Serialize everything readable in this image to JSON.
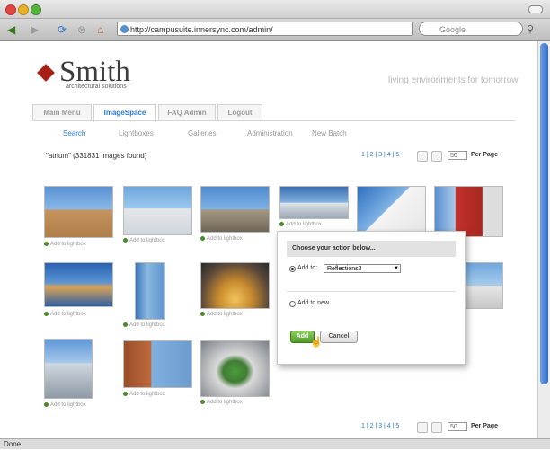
{
  "browser": {
    "url": "http://campusuite.innersync.com/admin/",
    "search_placeholder": "Google",
    "status": "Done"
  },
  "site": {
    "logo_name": "Smith",
    "logo_sub": "architectural solutions",
    "tagline": "living environments for tomorrow"
  },
  "tabs": [
    {
      "label": "Main Menu"
    },
    {
      "label": "ImageSpace"
    },
    {
      "label": "FAQ Admin"
    },
    {
      "label": "Logout"
    }
  ],
  "subnav": [
    "Search",
    "Lightboxes",
    "Galleries",
    "Administration",
    "New Batch"
  ],
  "results_text": "\"atrium\" (331831 images found)",
  "pager": {
    "pages": "1 | 2 | 3 | 4 | 5",
    "per_page_value": "50",
    "per_page_label": "Per Page"
  },
  "lightbox_label": "Add to lightbox",
  "popup": {
    "title": "Choose your action below...",
    "add_to_label": "Add to:",
    "selected_lightbox": "Reflections2",
    "add_new_label": "Add to new",
    "add_button": "Add",
    "cancel_button": "Cancel"
  },
  "colors": {
    "accent": "#2b7bd6",
    "brand": "#a62018",
    "add_green": "#5aa832"
  }
}
